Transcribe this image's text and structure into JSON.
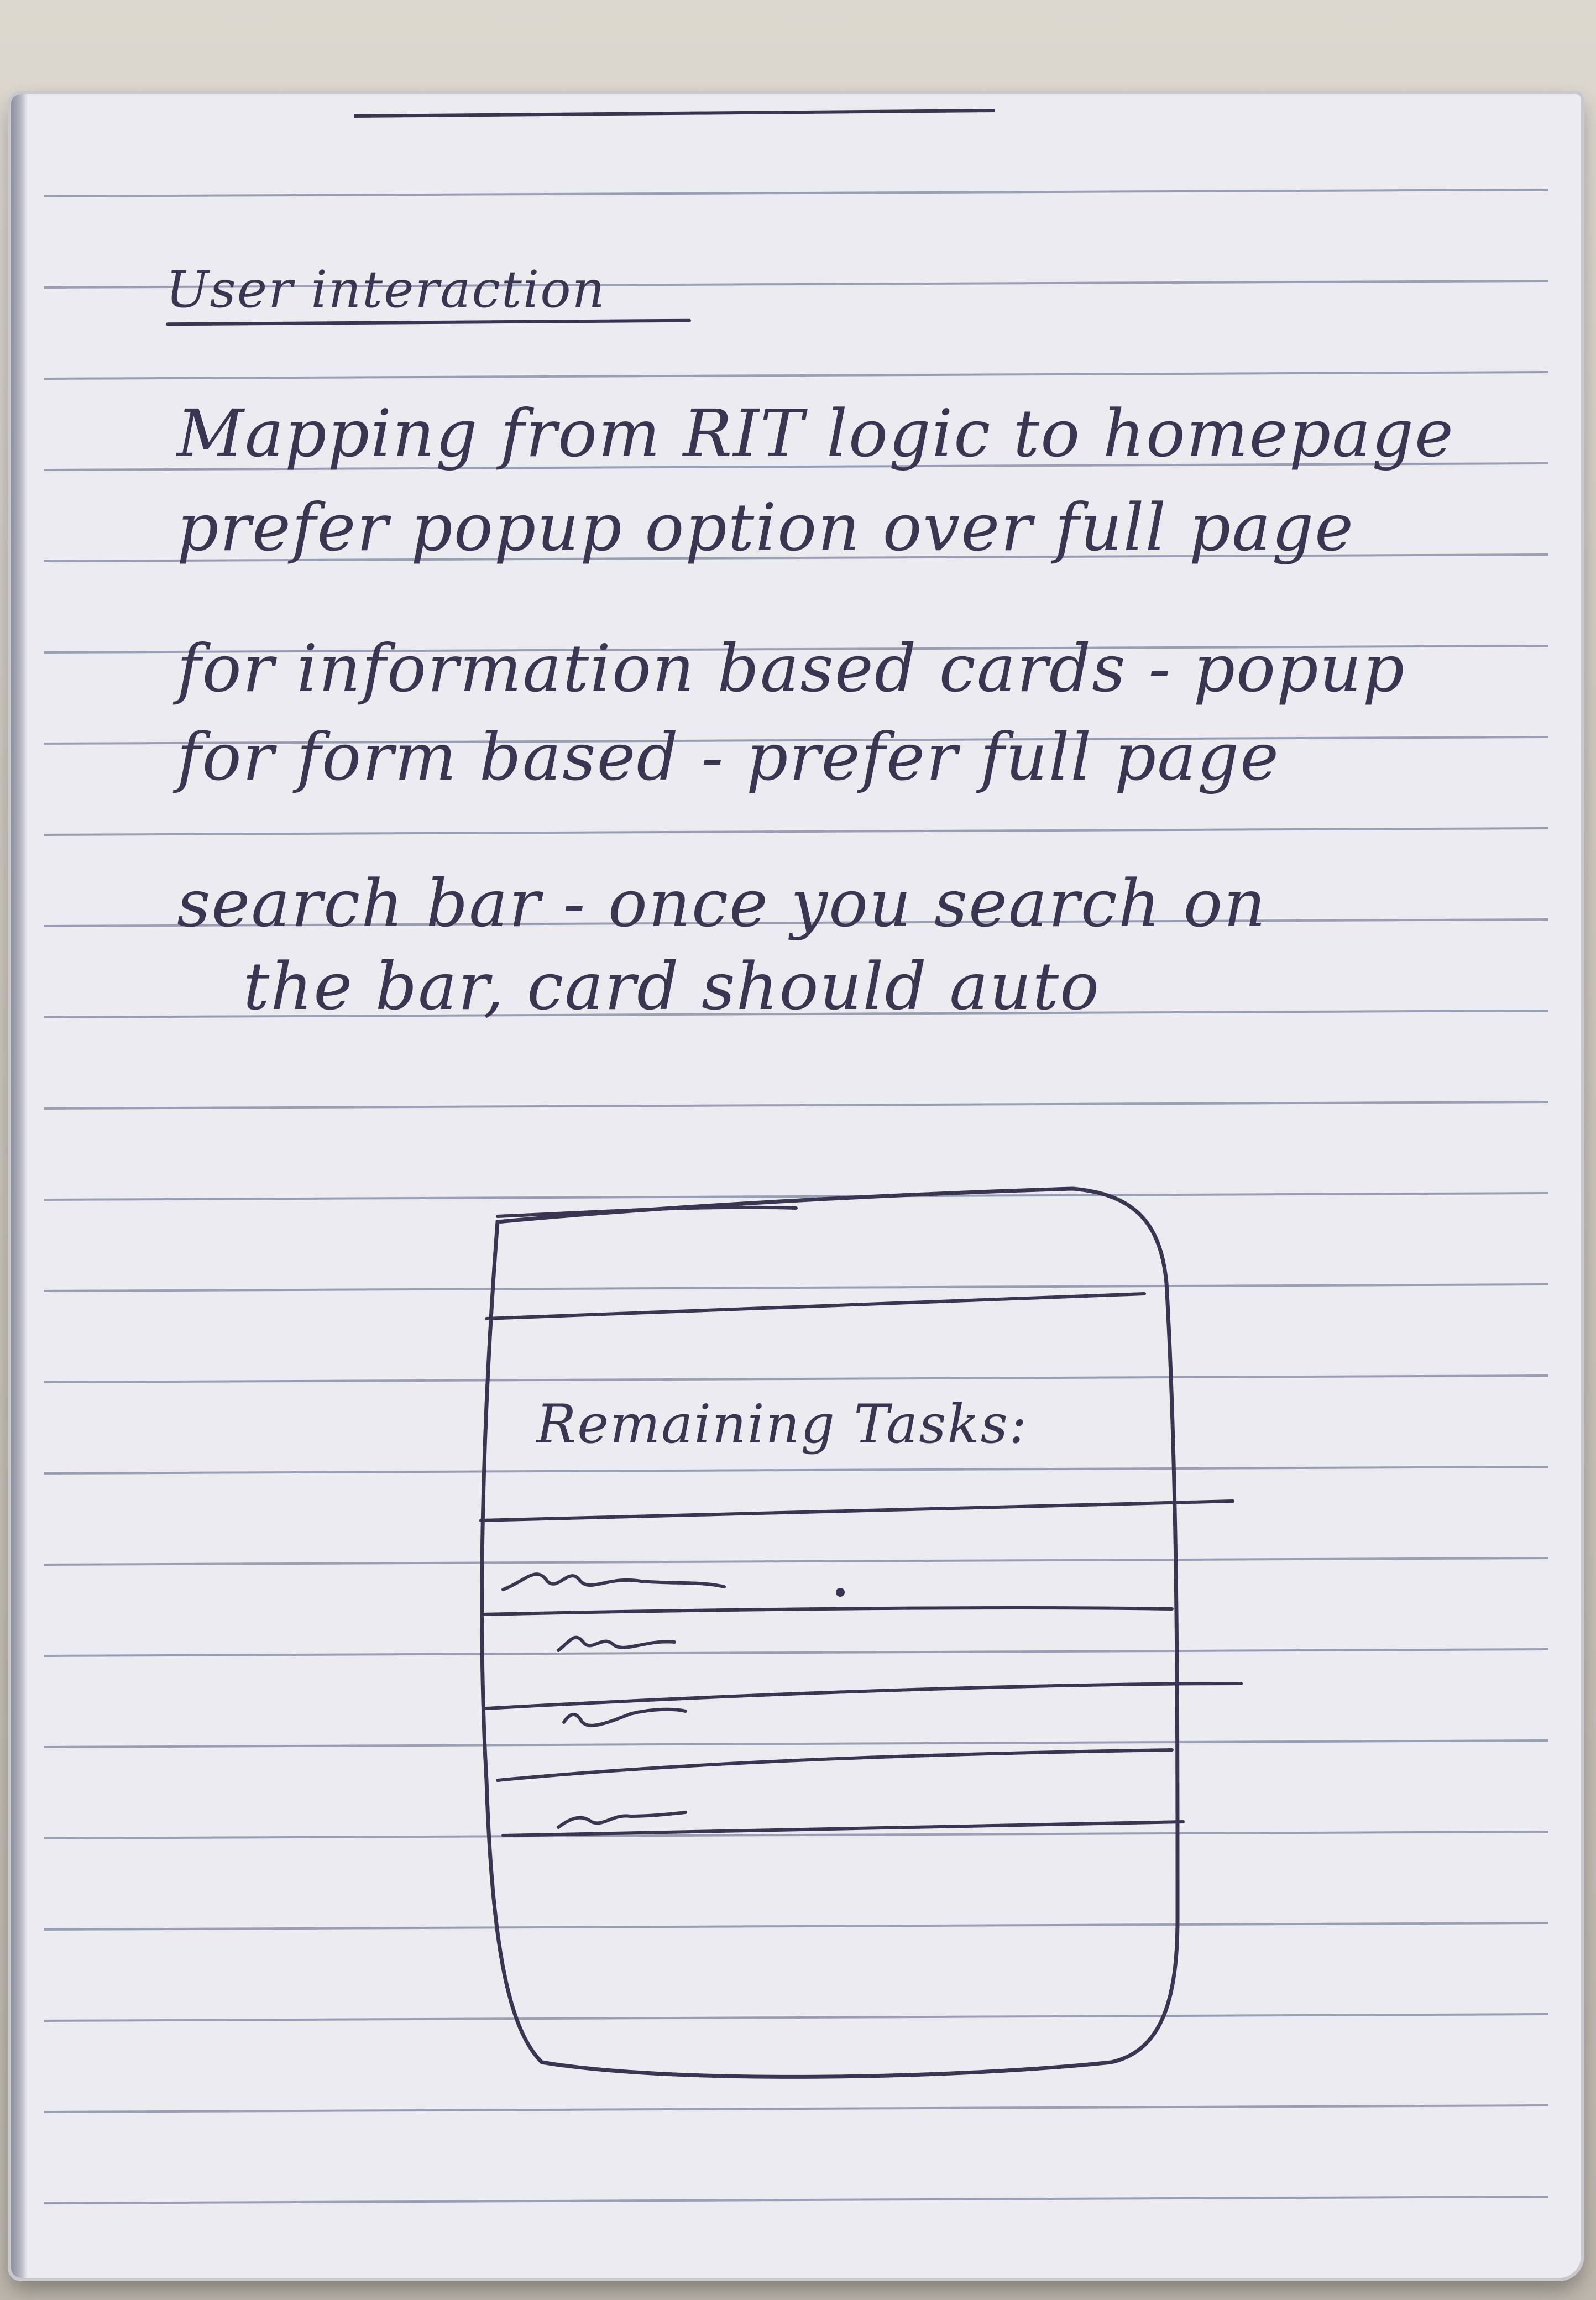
{
  "note": {
    "heading": "User interaction",
    "lines": [
      "Mapping from RIT logic to homepage",
      "prefer popup option over full page",
      "for information based cards - popup",
      "for form based - prefer full page",
      "search bar - once you search on",
      "the bar, card should auto"
    ]
  },
  "sketch": {
    "card_title": "Remaining Tasks:",
    "task_rows": 4
  },
  "colors": {
    "ink": "#3a3550",
    "paper": "#ebebf0",
    "rule": "#9a9db4"
  }
}
